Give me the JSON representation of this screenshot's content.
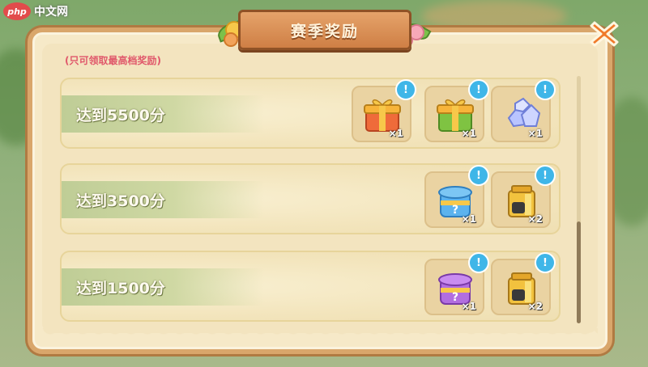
{
  "watermark": {
    "logo": "php",
    "text": "中文网"
  },
  "header": {
    "title": "赛季奖励"
  },
  "notice": "(只可领取最高档奖励)",
  "tiers": [
    {
      "label": "达到5500分",
      "rewards": [
        {
          "icon": "orange-gift-box-icon",
          "qty": "×1",
          "color": "#f0a23a"
        },
        {
          "icon": "green-gift-box-icon",
          "qty": "×1",
          "color": "#7fc342"
        },
        {
          "icon": "crystal-gems-icon",
          "qty": "×1",
          "color": "#a9b8ff"
        }
      ]
    },
    {
      "label": "达到3500分",
      "rewards": [
        {
          "icon": "blue-mystery-box-icon",
          "qty": "×1",
          "color": "#4fa9e8"
        },
        {
          "icon": "honey-jar-icon",
          "qty": "×2",
          "color": "#f2c23e"
        }
      ]
    },
    {
      "label": "达到1500分",
      "rewards": [
        {
          "icon": "purple-mystery-box-icon",
          "qty": "×1",
          "color": "#b26ee0"
        },
        {
          "icon": "honey-jar-icon",
          "qty": "×2",
          "color": "#f2c23e"
        }
      ]
    }
  ],
  "info_badge": "!",
  "colors": {
    "accent": "#3fb6e8",
    "close": "#f07a2a",
    "notice": "#e0586b"
  }
}
